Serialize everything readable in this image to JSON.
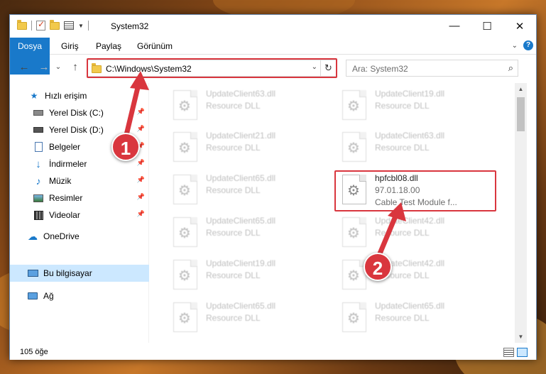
{
  "window": {
    "title": "System32",
    "controls": {
      "minimize": "—",
      "maximize": "☐",
      "close": "✕"
    }
  },
  "ribbon": {
    "tabs": [
      "Dosya",
      "Giriş",
      "Paylaş",
      "Görünüm"
    ],
    "help_label": "?"
  },
  "nav": {
    "back": "←",
    "forward": "→",
    "recent": "⌄",
    "up": "↑",
    "address": "C:\\Windows\\System32",
    "search_placeholder": "Ara: System32"
  },
  "sidebar": {
    "items": [
      {
        "label": "Hızlı erişim",
        "icon": "star-icon",
        "pinned": false
      },
      {
        "label": "Yerel Disk (C:)",
        "icon": "drive-icon",
        "pinned": true
      },
      {
        "label": "Yerel Disk (D:)",
        "icon": "drive-icon",
        "pinned": true
      },
      {
        "label": "Belgeler",
        "icon": "documents-icon",
        "pinned": true
      },
      {
        "label": "İndirmeler",
        "icon": "download-icon",
        "pinned": true
      },
      {
        "label": "Müzik",
        "icon": "music-icon",
        "pinned": true
      },
      {
        "label": "Resimler",
        "icon": "pictures-icon",
        "pinned": true
      },
      {
        "label": "Videolar",
        "icon": "videos-icon",
        "pinned": true
      },
      {
        "label": "OneDrive",
        "icon": "cloud-icon",
        "pinned": false
      },
      {
        "label": "Bu bilgisayar",
        "icon": "computer-icon",
        "pinned": false,
        "selected": true
      },
      {
        "label": "Ağ",
        "icon": "network-icon",
        "pinned": false
      }
    ]
  },
  "files": [
    {
      "name": "UpdateClient63.dll",
      "desc": "Resource DLL"
    },
    {
      "name": "UpdateClient19.dll",
      "desc": "Resource DLL"
    },
    {
      "name": "UpdateClient21.dll",
      "desc": "Resource DLL"
    },
    {
      "name": "UpdateClient63.dll",
      "desc": "Resource DLL"
    },
    {
      "name": "UpdateClient65.dll",
      "desc": "Resource DLL"
    },
    {
      "name": "hpfcbl08.dll",
      "desc": "97.01.18.00",
      "desc2": "Cable Test Module f...",
      "highlighted": true
    },
    {
      "name": "UpdateClient65.dll",
      "desc": "Resource DLL"
    },
    {
      "name": "UpdateClient42.dll",
      "desc": "Resource DLL"
    },
    {
      "name": "UpdateClient19.dll",
      "desc": "Resource DLL"
    },
    {
      "name": "UpdateClient42.dll",
      "desc": "Resource DLL"
    },
    {
      "name": "UpdateClient65.dll",
      "desc": "Resource DLL"
    },
    {
      "name": "UpdateClient65.dll",
      "desc": "Resource DLL"
    }
  ],
  "status": {
    "count": "105 öğe"
  },
  "annotations": {
    "step1": "1",
    "step2": "2",
    "color": "#d9363e"
  }
}
